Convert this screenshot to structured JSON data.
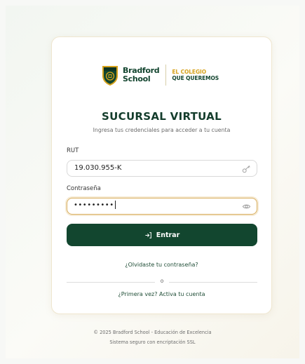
{
  "brand": {
    "name_line1": "Bradford",
    "name_line2": "School",
    "tagline_line1": "EL COLEGIO",
    "tagline_line2": "QUE QUEREMOS",
    "primary_color": "#12462f",
    "accent_color": "#d6a21c"
  },
  "login": {
    "title": "SUCURSAL VIRTUAL",
    "subtitle": "Ingresa tus credenciales para acceder a tu cuenta",
    "rut_label": "RUT",
    "rut_value": "19.030.955-K",
    "rut_icon": "key-icon",
    "password_label": "Contraseña",
    "password_masked": "•••••••••",
    "password_icon": "eye-icon",
    "submit_icon": "login-arrow-icon",
    "submit_label": "Entrar",
    "forgot_link": "¿Olvidaste tu contraseña?",
    "divider_text": "o",
    "activate_link": "¿Primera vez? Activa tu cuenta"
  },
  "footer": {
    "line1": "© 2025 Bradford School - Educación de Excelencia",
    "line2": "Sistema seguro con encriptación SSL"
  }
}
